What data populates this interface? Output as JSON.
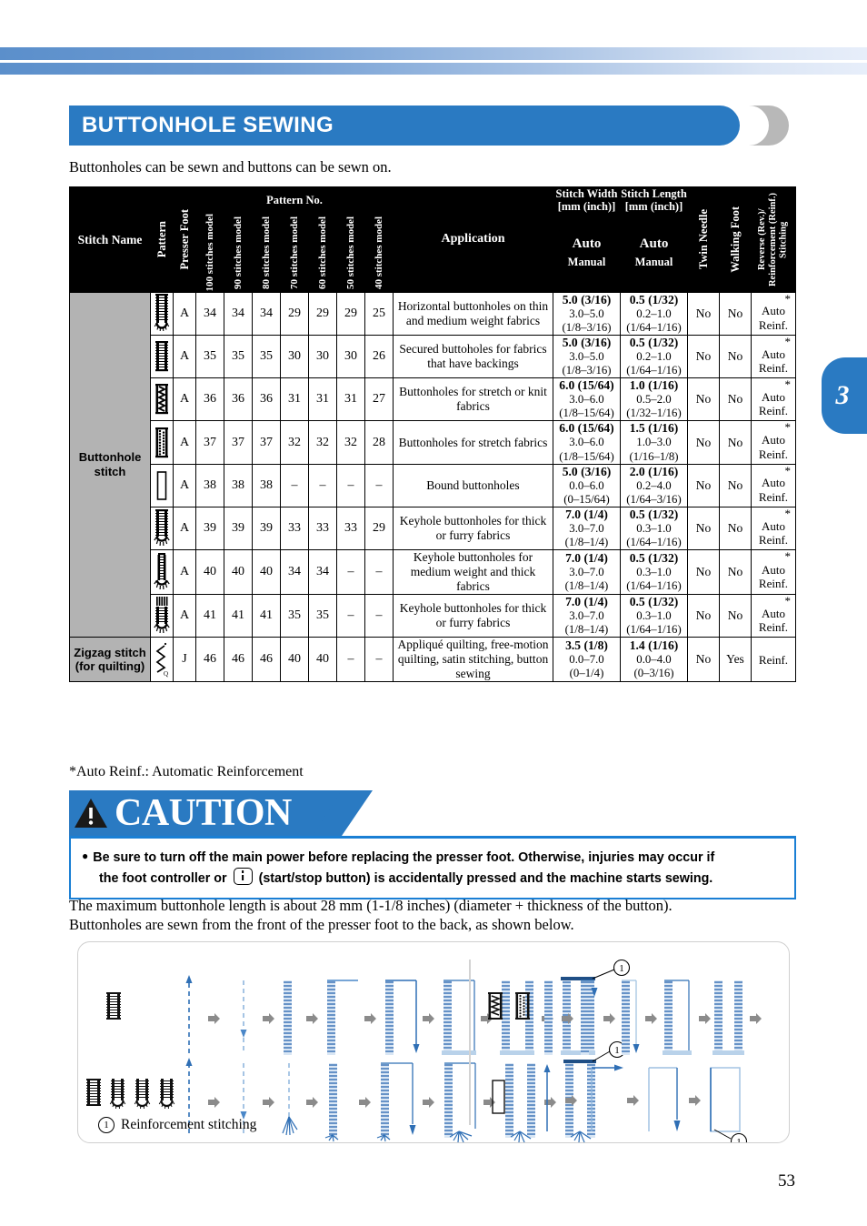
{
  "page": {
    "number": "53",
    "chapter_tab": "3"
  },
  "heading": {
    "title": "BUTTONHOLE SEWING"
  },
  "intro": "Buttonholes can be sewn and buttons can be sewn on.",
  "table": {
    "headers": {
      "stitch_name": "Stitch Name",
      "pattern": "Pattern",
      "presser_foot": "Presser Foot",
      "pattern_no": "Pattern No.",
      "models": [
        "100 stitches model",
        "90 stitches model",
        "80 stitches model",
        "70 stitches model",
        "60 stitches model",
        "50 stitches model",
        "40 stitches model"
      ],
      "application": "Application",
      "stitch_width": "Stitch Width [mm (inch)]",
      "stitch_width_l1": "Stitch Width",
      "stitch_width_l2": "[mm (inch)]",
      "stitch_length_l1": "Stitch Length",
      "stitch_length_l2": "[mm (inch)]",
      "auto": "Auto",
      "manual": "Manual",
      "twin_needle": "Twin Needle",
      "walking_foot": "Walking Foot",
      "reverse": "Reverse (Rev.)/ Reinforcement (Reinf.) Stitching",
      "reverse_l1": "Reverse (Rev.)/",
      "reverse_l2": "Reinforcement (Reinf.)",
      "reverse_l3": "Stitching"
    },
    "group_names": {
      "buttonhole": "Buttonhole stitch",
      "buttonhole_l1": "Buttonhole",
      "buttonhole_l2": "stitch",
      "zigzag_l1": "Zigzag stitch",
      "zigzag_l2": "(for quilting)"
    },
    "rows": [
      {
        "pattern_icon": "buttonhole-round-end-icon",
        "foot": "A",
        "nos": [
          "34",
          "34",
          "34",
          "29",
          "29",
          "29",
          "25"
        ],
        "application": "Horizontal buttonholes on thin and medium weight fabrics",
        "width_auto": "5.0 (3/16)",
        "width_range": "3.0–5.0",
        "width_range_in": "(1/8–3/16)",
        "length_auto": "0.5 (1/32)",
        "length_range": "0.2–1.0",
        "length_range_in": "(1/64–1/16)",
        "twin_needle": "No",
        "walking_foot": "No",
        "reverse": "Auto Reinf.",
        "reverse_l1": "Auto",
        "reverse_l2": "Reinf.",
        "star": "*"
      },
      {
        "pattern_icon": "buttonhole-square-icon",
        "foot": "A",
        "nos": [
          "35",
          "35",
          "35",
          "30",
          "30",
          "30",
          "26"
        ],
        "application": "Secured buttoholes for fabrics that have backings",
        "width_auto": "5.0 (3/16)",
        "width_range": "3.0–5.0",
        "width_range_in": "(1/8–3/16)",
        "length_auto": "0.5 (1/32)",
        "length_range": "0.2–1.0",
        "length_range_in": "(1/64–1/16)",
        "twin_needle": "No",
        "walking_foot": "No",
        "reverse": "Auto Reinf.",
        "reverse_l1": "Auto",
        "reverse_l2": "Reinf.",
        "star": "*"
      },
      {
        "pattern_icon": "buttonhole-stretch-icon",
        "foot": "A",
        "nos": [
          "36",
          "36",
          "36",
          "31",
          "31",
          "31",
          "27"
        ],
        "application": "Buttonholes for stretch or knit fabrics",
        "width_auto": "6.0 (15/64)",
        "width_range": "3.0–6.0",
        "width_range_in": "(1/8–15/64)",
        "length_auto": "1.0 (1/16)",
        "length_range": "0.5–2.0",
        "length_range_in": "(1/32–1/16)",
        "twin_needle": "No",
        "walking_foot": "No",
        "reverse": "Auto Reinf.",
        "reverse_l1": "Auto",
        "reverse_l2": "Reinf.",
        "star": "*"
      },
      {
        "pattern_icon": "buttonhole-knit-icon",
        "foot": "A",
        "nos": [
          "37",
          "37",
          "37",
          "32",
          "32",
          "32",
          "28"
        ],
        "application": "Buttonholes for stretch fabrics",
        "width_auto": "6.0 (15/64)",
        "width_range": "3.0–6.0",
        "width_range_in": "(1/8–15/64)",
        "length_auto": "1.5 (1/16)",
        "length_range": "1.0–3.0",
        "length_range_in": "(1/16–1/8)",
        "twin_needle": "No",
        "walking_foot": "No",
        "reverse": "Auto Reinf.",
        "reverse_l1": "Auto",
        "reverse_l2": "Reinf.",
        "star": "*"
      },
      {
        "pattern_icon": "bound-buttonhole-icon",
        "foot": "A",
        "nos": [
          "38",
          "38",
          "38",
          "–",
          "–",
          "–",
          "–"
        ],
        "application": "Bound buttonholes",
        "width_auto": "5.0 (3/16)",
        "width_range": "0.0–6.0",
        "width_range_in": "(0–15/64)",
        "length_auto": "2.0 (1/16)",
        "length_range": "0.2–4.0",
        "length_range_in": "(1/64–3/16)",
        "twin_needle": "No",
        "walking_foot": "No",
        "reverse": "Auto Reinf.",
        "reverse_l1": "Auto",
        "reverse_l2": "Reinf.",
        "star": "*"
      },
      {
        "pattern_icon": "keyhole-buttonhole-icon",
        "foot": "A",
        "nos": [
          "39",
          "39",
          "39",
          "33",
          "33",
          "33",
          "29"
        ],
        "application": "Keyhole buttonholes for thick or furry fabrics",
        "width_auto": "7.0 (1/4)",
        "width_range": "3.0–7.0",
        "width_range_in": "(1/8–1/4)",
        "length_auto": "0.5 (1/32)",
        "length_range": "0.3–1.0",
        "length_range_in": "(1/64–1/16)",
        "twin_needle": "No",
        "walking_foot": "No",
        "reverse": "Auto Reinf.",
        "reverse_l1": "Auto",
        "reverse_l2": "Reinf.",
        "star": "*"
      },
      {
        "pattern_icon": "keyhole-buttonhole-tapered-icon",
        "foot": "A",
        "nos": [
          "40",
          "40",
          "40",
          "34",
          "34",
          "–",
          "–"
        ],
        "application": "Keyhole buttonholes for medium weight and thick fabrics",
        "width_auto": "7.0 (1/4)",
        "width_range": "3.0–7.0",
        "width_range_in": "(1/8–1/4)",
        "length_auto": "0.5 (1/32)",
        "length_range": "0.3–1.0",
        "length_range_in": "(1/64–1/16)",
        "twin_needle": "No",
        "walking_foot": "No",
        "reverse": "Auto Reinf.",
        "reverse_l1": "Auto",
        "reverse_l2": "Reinf.",
        "star": "*"
      },
      {
        "pattern_icon": "keyhole-buttonhole-bartack-icon",
        "foot": "A",
        "nos": [
          "41",
          "41",
          "41",
          "35",
          "35",
          "–",
          "–"
        ],
        "application": "Keyhole buttonholes for thick or furry fabrics",
        "width_auto": "7.0 (1/4)",
        "width_range": "3.0–7.0",
        "width_range_in": "(1/8–1/4)",
        "length_auto": "0.5 (1/32)",
        "length_range": "0.3–1.0",
        "length_range_in": "(1/64–1/16)",
        "twin_needle": "No",
        "walking_foot": "No",
        "reverse": "Auto Reinf.",
        "reverse_l1": "Auto",
        "reverse_l2": "Reinf.",
        "star": "*"
      },
      {
        "pattern_icon": "zigzag-quilting-icon",
        "foot": "J",
        "nos": [
          "46",
          "46",
          "46",
          "40",
          "40",
          "–",
          "–"
        ],
        "application": "Appliqué quilting, free-motion quilting, satin stitching, button sewing",
        "width_auto": "3.5 (1/8)",
        "width_range": "0.0–7.0",
        "width_range_in": "(0–1/4)",
        "length_auto": "1.4 (1/16)",
        "length_range": "0.0–4.0",
        "length_range_in": "(0–3/16)",
        "twin_needle": "No",
        "walking_foot": "Yes",
        "reverse": "Reinf.",
        "reverse_l1": "Reinf.",
        "reverse_l2": "",
        "star": ""
      }
    ]
  },
  "footnote": "*Auto Reinf.: Automatic Reinforcement",
  "caution": {
    "label": "CAUTION",
    "bullet": "●",
    "line1": "Be sure to turn off the main power before replacing the presser foot. Otherwise, injuries may occur if",
    "line2_a": "the foot controller or",
    "line2_b": "(start/stop button) is accidentally pressed and the machine starts sewing."
  },
  "max_length_para": {
    "line1": "The maximum buttonhole length is about 28 mm (1-1/8 inches) (diameter + thickness of the button).",
    "line2": "Buttonholes are sewn from the front of the presser foot to the back, as shown below."
  },
  "figure": {
    "caption_number": "1",
    "caption_text": "Reinforcement stitching",
    "callout_number": "1"
  },
  "colors": {
    "accent_blue": "#2a7ac2",
    "caution_blue": "#1a7fd4",
    "stitch_blue": "#4a87c8",
    "header_black": "#000000",
    "row_label_gray": "#b3b3b3"
  }
}
